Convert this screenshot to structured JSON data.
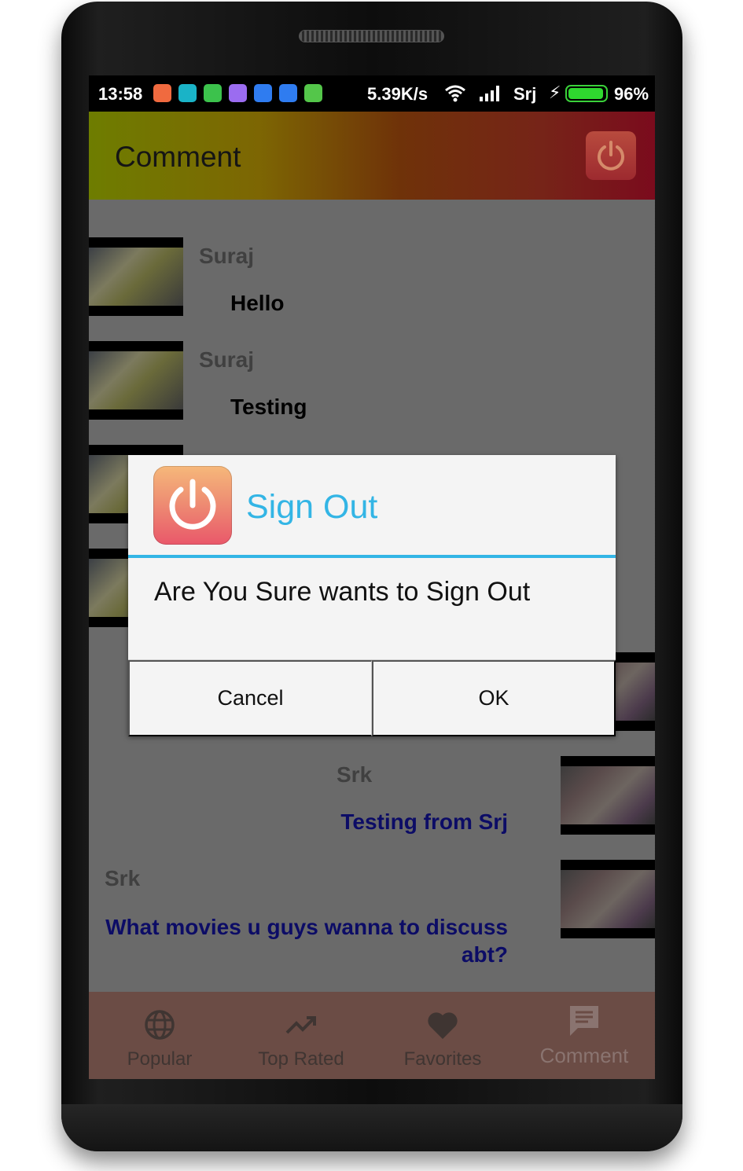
{
  "status_bar": {
    "time": "13:58",
    "speed": "5.39K/s",
    "carrier": "Srj",
    "battery_percent": "96%",
    "battery_level": 0.96,
    "notification_icons": [
      {
        "name": "shop-icon",
        "color": "#f06a3f"
      },
      {
        "name": "chat-bubble-icon",
        "color": "#1ab3c7"
      },
      {
        "name": "battery-saver-icon",
        "color": "#3cc24c"
      },
      {
        "name": "galaxy-icon",
        "color": "#9b6cf0"
      },
      {
        "name": "message-icon",
        "color": "#2f7cf0"
      },
      {
        "name": "message-alt-icon",
        "color": "#2f7cf0"
      },
      {
        "name": "android-icon",
        "color": "#54c64a"
      }
    ]
  },
  "app_bar": {
    "title": "Comment",
    "sign_out_icon": "power-icon"
  },
  "comments": [
    {
      "name": "Suraj",
      "text": "Hello",
      "side": "left"
    },
    {
      "name": "Suraj",
      "text": "Testing",
      "side": "left"
    },
    {
      "name": "Srk",
      "text": "Testing from Srj",
      "side": "right"
    },
    {
      "name": "Srk",
      "text": "What movies u guys wanna  to discuss abt?",
      "side": "right"
    }
  ],
  "bottom_nav": [
    {
      "label": "Popular",
      "icon": "globe-icon"
    },
    {
      "label": "Top Rated",
      "icon": "trending-up-icon"
    },
    {
      "label": "Favorites",
      "icon": "heart-icon"
    },
    {
      "label": "Comment",
      "icon": "comment-icon",
      "active": true
    }
  ],
  "dialog": {
    "title": "Sign Out",
    "icon": "power-icon",
    "message": "Are You Sure wants to Sign Out",
    "cancel_label": "Cancel",
    "ok_label": "OK"
  },
  "colors": {
    "dialog_accent": "#33b5e5",
    "comment_blue": "#0c0c66",
    "battery_green": "#2fd82f"
  }
}
